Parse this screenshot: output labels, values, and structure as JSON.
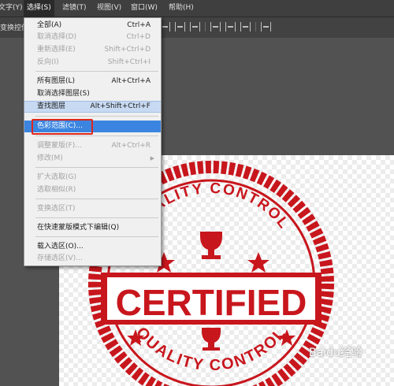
{
  "menubar": {
    "items": [
      {
        "label": "文字(Y)",
        "active": false
      },
      {
        "label": "选择(S)",
        "active": true
      },
      {
        "label": "滤镜(T)",
        "active": false
      },
      {
        "label": "视图(V)",
        "active": false
      },
      {
        "label": "窗口(W)",
        "active": false
      },
      {
        "label": "帮助(H)",
        "active": false
      }
    ]
  },
  "options_bar": {
    "label": "变换控件"
  },
  "select_menu": {
    "items": [
      {
        "label": "全部(A)",
        "shortcut": "Ctrl+A"
      },
      {
        "label": "取消选择(D)",
        "shortcut": "Ctrl+D"
      },
      {
        "label": "重新选择(E)",
        "shortcut": "Shift+Ctrl+D"
      },
      {
        "label": "反向(I)",
        "shortcut": "Shift+Ctrl+I"
      },
      {
        "label": "所有图层(L)",
        "shortcut": "Alt+Ctrl+A"
      },
      {
        "label": "取消选择图层(S)",
        "shortcut": ""
      },
      {
        "label": "查找图层",
        "shortcut": "Alt+Shift+Ctrl+F"
      },
      {
        "label": "色彩范围(C)...",
        "shortcut": ""
      },
      {
        "label": "调整蒙版(F)...",
        "shortcut": "Alt+Ctrl+R"
      },
      {
        "label": "修改(M)",
        "shortcut": ""
      },
      {
        "label": "扩大选取(G)",
        "shortcut": ""
      },
      {
        "label": "选取相似(R)",
        "shortcut": ""
      },
      {
        "label": "变换选区(T)",
        "shortcut": ""
      },
      {
        "label": "在快速蒙版模式下编辑(Q)",
        "shortcut": ""
      },
      {
        "label": "载入选区(O)...",
        "shortcut": ""
      },
      {
        "label": "存储选区(V)...",
        "shortcut": ""
      }
    ]
  },
  "stamp": {
    "top_text": "QUALITY CONTROL",
    "main_text": "CERTIFIED",
    "bottom_text": "QUALITY CONTROL"
  },
  "watermark": {
    "text": "Baidu经验"
  },
  "colors": {
    "stamp_red": "#c8161d",
    "highlight": "#e0261a",
    "selected": "#3b85e0"
  }
}
